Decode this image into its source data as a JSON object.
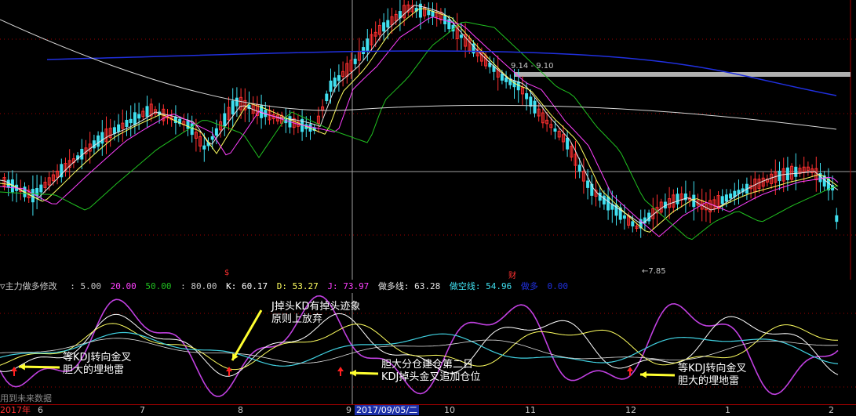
{
  "indicator": {
    "name": "主力做多修改",
    "p1": ": 5.00",
    "p2": "20.00",
    "p3": "50.00",
    "p4": ": 80.00",
    "k": "K: 60.17",
    "d": "D: 53.27",
    "j": "J: 73.97",
    "long_line": "做多线: 63.28",
    "short_line": "做空线: 54.96",
    "long": "做多",
    "long_val": "0.00"
  },
  "price_labels": {
    "range": "9.14 - 9.10",
    "low": "←7.85",
    "marker_s": "$",
    "marker_cai": "财"
  },
  "annotations": {
    "a1_line1": "J掉头KD有掉头迹象",
    "a1_line2": "原则上放弃",
    "a2_line1": "等KDJ转向金叉",
    "a2_line2": "胆大的埋地雷",
    "a3_line1": "胆大分仓建仓第二日",
    "a3_line2": "KDJ掉头金叉追加仓位",
    "a4_line1": "等KDJ转向金叉",
    "a4_line2": "胆大的埋地雷"
  },
  "axis": {
    "months": [
      "2017年",
      "6",
      "7",
      "8",
      "9",
      "10",
      "11",
      "12",
      "1",
      "2"
    ],
    "selected_date": "2017/09/05/二"
  },
  "footer_note": "用到未来数据",
  "colors": {
    "background": "#000000",
    "up": "#ff3030",
    "down": "#40e0f0",
    "ma_white": "#e8e8e8",
    "ma_yellow": "#ffff60",
    "ma_magenta": "#ff40ff",
    "ma_green": "#20c020",
    "ma_blue": "#2030e0",
    "grid_red": "#a00000"
  }
}
